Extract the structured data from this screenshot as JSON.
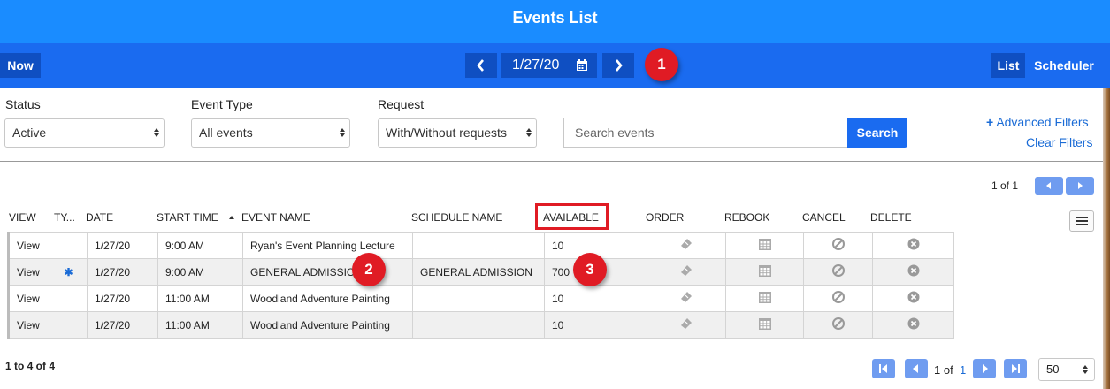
{
  "header": {
    "title": "Events List"
  },
  "nav": {
    "now_label": "Now",
    "date": "1/27/20",
    "list_label": "List",
    "scheduler_label": "Scheduler",
    "badge1": "1"
  },
  "filters": {
    "status_label": "Status",
    "status_value": "Active",
    "event_type_label": "Event Type",
    "event_type_value": "All events",
    "request_label": "Request",
    "request_value": "With/Without requests",
    "search_placeholder": "Search events",
    "search_button": "Search",
    "advanced_filters": "Advanced Filters",
    "clear_filters": "Clear Filters"
  },
  "top_pager": {
    "text": "1 of 1"
  },
  "columns": [
    "VIEW",
    "TY...",
    "DATE",
    "START TIME",
    "EVENT NAME",
    "SCHEDULE NAME",
    "AVAILABLE",
    "ORDER",
    "REBOOK",
    "CANCEL",
    "DELETE"
  ],
  "rows": [
    {
      "view": "View",
      "type": "",
      "date": "1/27/20",
      "start": "9:00 AM",
      "name": "Ryan's Event Planning Lecture",
      "schedule": "",
      "available": "10"
    },
    {
      "view": "View",
      "type": "✱",
      "date": "1/27/20",
      "start": "9:00 AM",
      "name": "GENERAL ADMISSION",
      "schedule": "GENERAL ADMISSION",
      "available": "700"
    },
    {
      "view": "View",
      "type": "",
      "date": "1/27/20",
      "start": "11:00 AM",
      "name": "Woodland Adventure Painting",
      "schedule": "",
      "available": "10"
    },
    {
      "view": "View",
      "type": "",
      "date": "1/27/20",
      "start": "11:00 AM",
      "name": "Woodland Adventure Painting",
      "schedule": "",
      "available": "10"
    }
  ],
  "badges": {
    "b2": "2",
    "b3": "3"
  },
  "footer": {
    "count_text": "1 to 4 of 4",
    "page_of": "1 of",
    "page_total": "1",
    "page_size": "50"
  },
  "colors": {
    "header": "#1a8cff",
    "navbar": "#1a6bf0",
    "accent": "#1a6bd6",
    "badge": "#e01b24"
  }
}
